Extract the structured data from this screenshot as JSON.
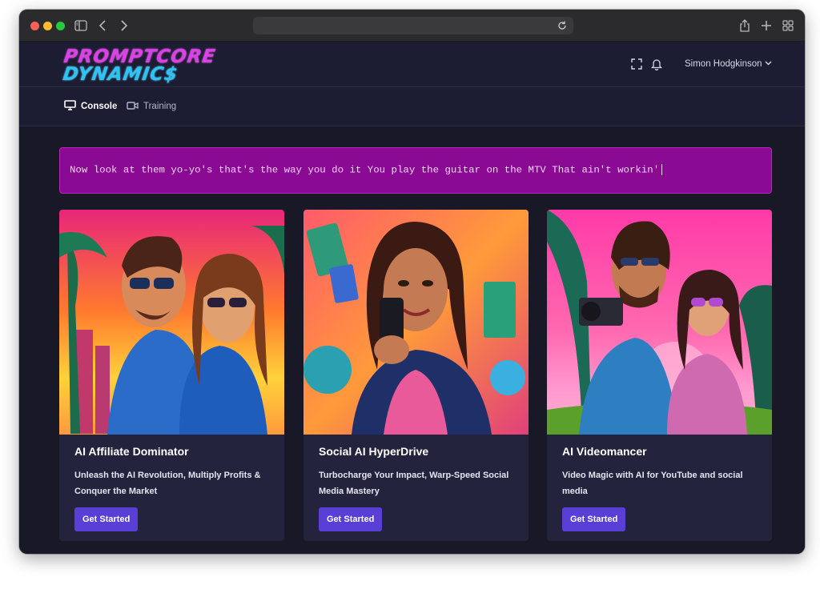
{
  "header": {
    "logo_line1": "PROMPTCORE",
    "logo_line2": "DYNAMIC$",
    "user_name": "Simon Hodgkinson"
  },
  "nav": {
    "items": [
      {
        "label": "Console",
        "icon": "monitor-icon",
        "active": true
      },
      {
        "label": "Training",
        "icon": "video-camera-icon",
        "active": false
      }
    ]
  },
  "banner": {
    "text": "Now look at them yo-yo's that's the way you do it You play the guitar on the MTV That ain't workin'"
  },
  "cards": [
    {
      "title": "AI Affiliate Dominator",
      "description": "Unleash the AI Revolution, Multiply Profits & Conquer the Market",
      "button": "Get Started"
    },
    {
      "title": "Social AI HyperDrive",
      "description": "Turbocharge Your Impact, Warp-Speed Social Media Mastery",
      "button": "Get Started"
    },
    {
      "title": "AI Videomancer",
      "description": "Video Magic with AI for YouTube and social media",
      "button": "Get Started"
    }
  ],
  "colors": {
    "banner_bg": "#8a0a93",
    "button_bg": "#5a3fd6",
    "card_bg": "#23233e",
    "page_bg": "#181827"
  }
}
